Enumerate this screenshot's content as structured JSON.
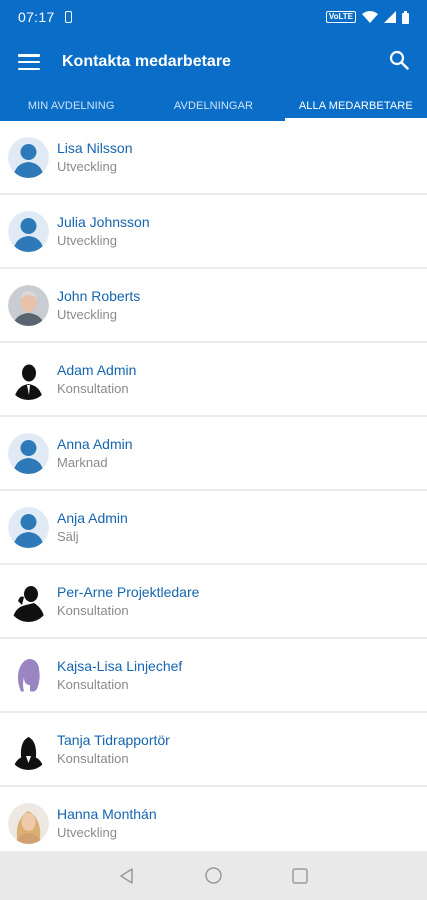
{
  "status": {
    "time": "07:17",
    "volte": "VoLTE"
  },
  "header": {
    "title": "Kontakta medarbetare"
  },
  "tabs": [
    {
      "label": "MIN AVDELNING",
      "active": false
    },
    {
      "label": "AVDELNINGAR",
      "active": false
    },
    {
      "label": "ALLA MEDARBETARE",
      "active": true
    }
  ],
  "contacts": [
    {
      "name": "Lisa Nilsson",
      "department": "Utveckling",
      "avatar": "default-person-icon"
    },
    {
      "name": "Julia Johnsson",
      "department": "Utveckling",
      "avatar": "default-person-icon"
    },
    {
      "name": "John Roberts",
      "department": "Utveckling",
      "avatar": "man-photo"
    },
    {
      "name": "Adam Admin",
      "department": "Konsultation",
      "avatar": "man-silhouette-icon"
    },
    {
      "name": "Anna Admin",
      "department": "Marknad",
      "avatar": "default-person-icon"
    },
    {
      "name": "Anja Admin",
      "department": "Sälj",
      "avatar": "default-person-icon"
    },
    {
      "name": "Per-Arne Projektledare",
      "department": "Konsultation",
      "avatar": "man-phone-silhouette-icon"
    },
    {
      "name": "Kajsa-Lisa Linjechef",
      "department": "Konsultation",
      "avatar": "woman-purple-silhouette-icon"
    },
    {
      "name": "Tanja Tidrapportör",
      "department": "Konsultation",
      "avatar": "woman-silhouette-icon"
    },
    {
      "name": "Hanna Monthán",
      "department": "Utveckling",
      "avatar": "woman-photo"
    }
  ],
  "colors": {
    "primary": "#0a6ec8",
    "name_text": "#1565b0",
    "secondary_text": "#8a8a8a"
  }
}
